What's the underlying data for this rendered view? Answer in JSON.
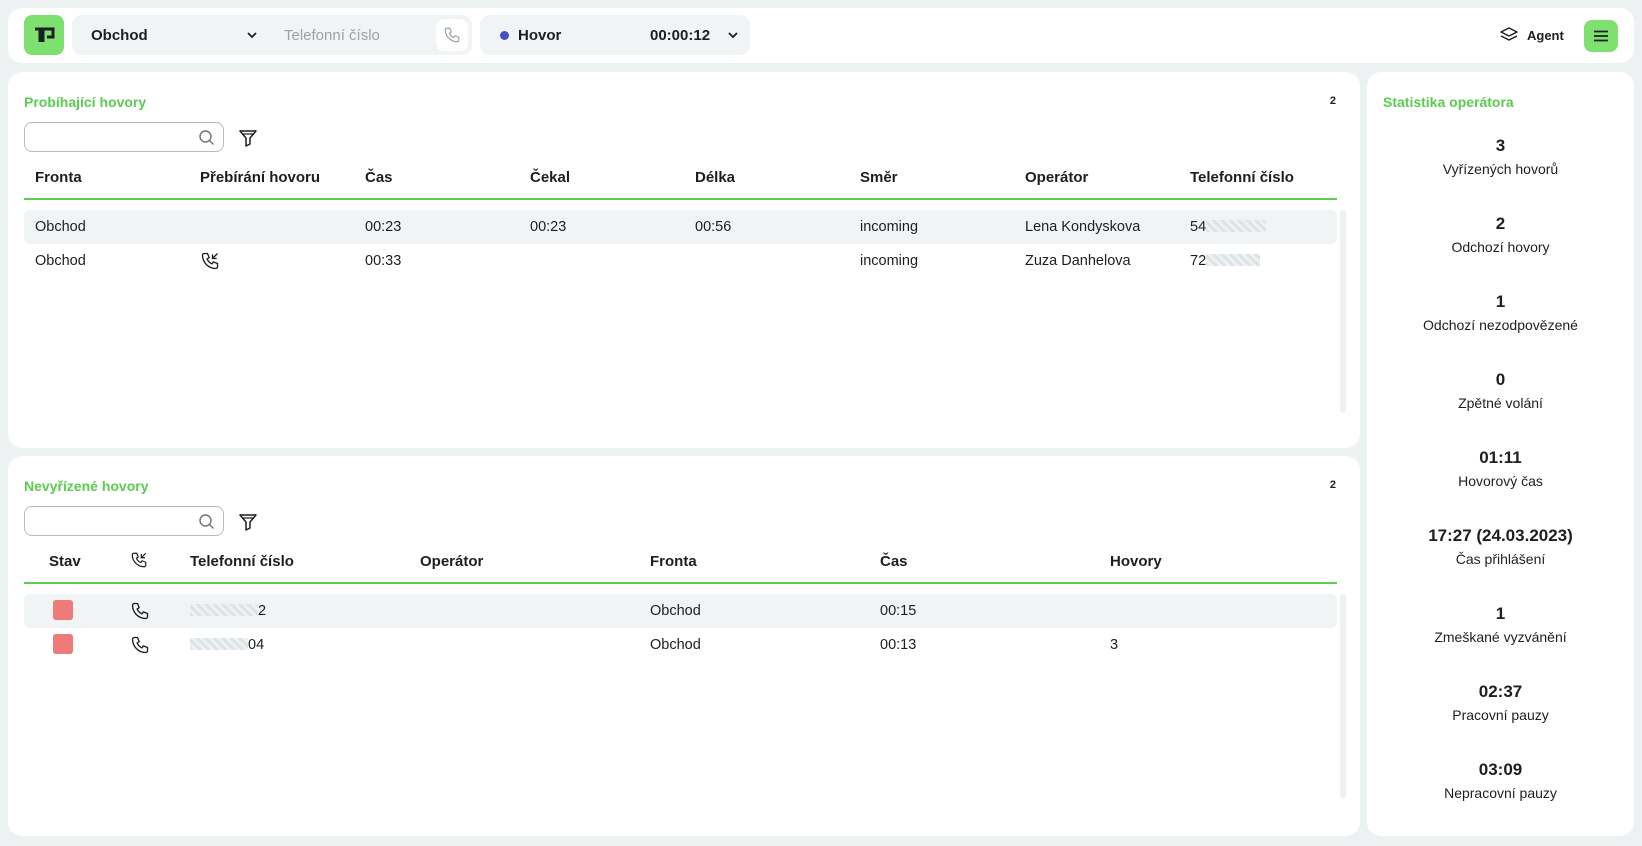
{
  "colors": {
    "accent": "#7ee06e",
    "title_green": "#5ccb50",
    "status_dot": "#4052c4",
    "stav_red": "#ee7b79",
    "background": "#eef1f2"
  },
  "topbar": {
    "logo_icon": "app-logo-icon",
    "queue_value": "Obchod",
    "phone_placeholder": "Telefonní číslo",
    "status_label": "Hovor",
    "status_timer": "00:00:12",
    "agent_label": "Agent",
    "agent_icon": "layers-icon",
    "menu_icon": "hamburger-menu-icon"
  },
  "ongoing": {
    "title": "Probíhající hovory",
    "count": "2",
    "search_placeholder": "",
    "columns": [
      "Fronta",
      "Přebírání hovoru",
      "Čas",
      "Čekal",
      "Délka",
      "Směr",
      "Operátor",
      "Telefonní číslo"
    ],
    "rows": [
      {
        "fronta": "Obchod",
        "pickup_icon": "",
        "cas": "00:23",
        "cekal": "00:23",
        "delka": "00:56",
        "smer": "incoming",
        "operator": "Lena Kondyskova",
        "phone_prefix": "54"
      },
      {
        "fronta": "Obchod",
        "pickup_icon": "phone-incoming-icon",
        "cas": "00:33",
        "cekal": "",
        "delka": "",
        "smer": "incoming",
        "operator": "Zuza Danhelova",
        "phone_prefix": "72"
      }
    ]
  },
  "unresolved": {
    "title": "Nevyřízené hovory",
    "count": "2",
    "search_placeholder": "",
    "columns": [
      "Stav",
      "",
      "Telefonní číslo",
      "Operátor",
      "Fronta",
      "Čas",
      "Hovory"
    ],
    "rows": [
      {
        "phone_suffix": "2",
        "operator": "",
        "fronta": "Obchod",
        "cas": "00:15",
        "hovory": ""
      },
      {
        "phone_suffix": "04",
        "operator": "",
        "fronta": "Obchod",
        "cas": "00:13",
        "hovory": "3"
      }
    ]
  },
  "stats": {
    "title": "Statistika operátora",
    "items": [
      {
        "value": "3",
        "label": "Vyřízených hovorů"
      },
      {
        "value": "2",
        "label": "Odchozí hovory"
      },
      {
        "value": "1",
        "label": "Odchozí nezodpovězené"
      },
      {
        "value": "0",
        "label": "Zpětné volání"
      },
      {
        "value": "01:11",
        "label": "Hovorový čas"
      },
      {
        "value": "17:27 (24.03.2023)",
        "label": "Čas přihlášení"
      },
      {
        "value": "1",
        "label": "Zmeškané vyzvánění"
      },
      {
        "value": "02:37",
        "label": "Pracovní pauzy"
      },
      {
        "value": "03:09",
        "label": "Nepracovní pauzy"
      }
    ]
  }
}
